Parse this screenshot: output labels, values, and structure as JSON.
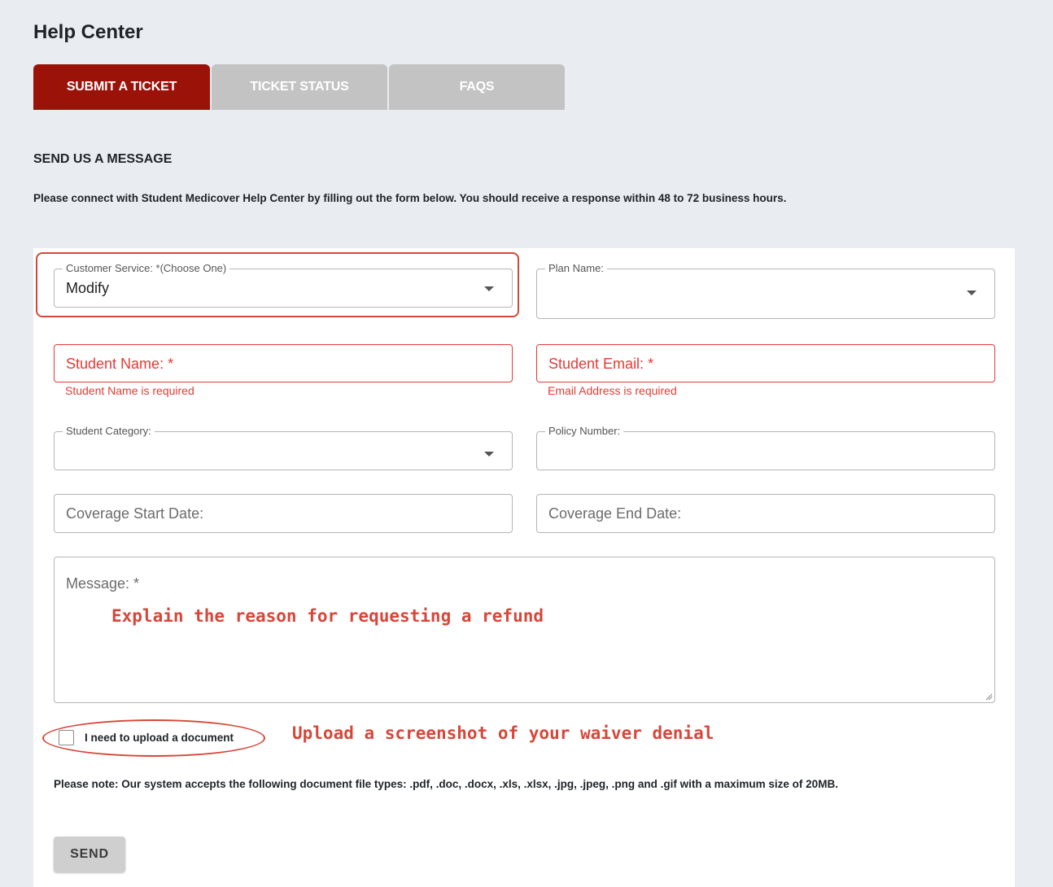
{
  "page": {
    "title": "Help Center"
  },
  "tabs": [
    {
      "label": "SUBMIT A TICKET",
      "active": true
    },
    {
      "label": "TICKET STATUS",
      "active": false
    },
    {
      "label": "FAQS",
      "active": false
    }
  ],
  "section": {
    "title": "SEND US A MESSAGE",
    "intro": "Please connect with Student Medicover Help Center by filling out the form below. You should receive a response within 48 to 72 business hours."
  },
  "form": {
    "customer_service": {
      "legend": "Customer Service: *(Choose One)",
      "value": "Modify"
    },
    "plan_name": {
      "legend": "Plan Name:",
      "value": ""
    },
    "student_name": {
      "placeholder": "Student Name: *",
      "error": "Student Name is required"
    },
    "student_email": {
      "placeholder": "Student Email: *",
      "error": "Email Address is required"
    },
    "student_category": {
      "legend": "Student Category:",
      "value": ""
    },
    "policy_number": {
      "legend": "Policy Number:",
      "value": ""
    },
    "coverage_start": {
      "placeholder": "Coverage Start Date:"
    },
    "coverage_end": {
      "placeholder": "Coverage End Date:"
    },
    "message": {
      "placeholder": "Message: *"
    },
    "upload_checkbox": {
      "label": "I need to upload a document",
      "checked": false
    },
    "note": "Please note: Our system accepts the following document file types: .pdf, .doc, .docx, .xls, .xlsx, .jpg, .jpeg, .png and .gif with a maximum size of 20MB.",
    "send_label": "SEND"
  },
  "annotations": {
    "message_hint": "Explain the reason for requesting a refund",
    "upload_hint": "Upload a screenshot of your waiver denial",
    "color": "#d6473a"
  },
  "colors": {
    "active_tab": "#9b1209",
    "inactive_tab": "#c3c3c3",
    "error": "#e53935",
    "background": "#e9ecf1"
  }
}
